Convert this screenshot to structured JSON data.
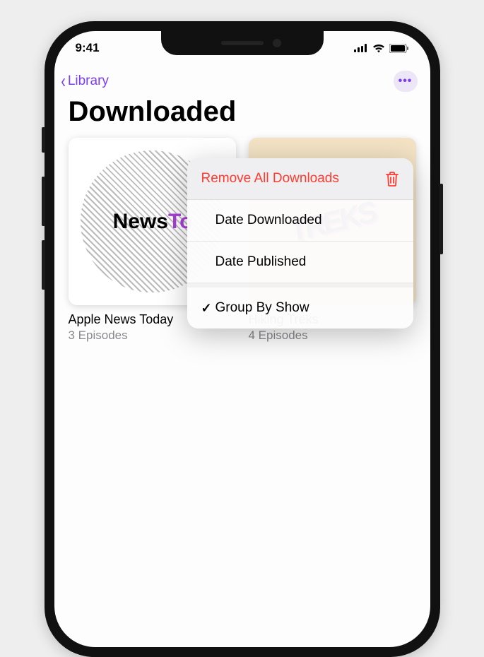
{
  "status_bar": {
    "time": "9:41"
  },
  "nav": {
    "back_label": "Library",
    "more_label": "•••"
  },
  "page": {
    "title": "Downloaded"
  },
  "shows": [
    {
      "title": "Apple News Today",
      "subtitle": "3 Episodes",
      "art_text_1": "News",
      "art_text_2": "To"
    },
    {
      "title": "Hiking Treks",
      "subtitle": "4 Episodes",
      "art_text": "TREKS"
    }
  ],
  "menu": {
    "items": [
      {
        "label": "Remove All Downloads",
        "destructive": true,
        "icon": "trash"
      },
      {
        "label": "Date Downloaded"
      },
      {
        "label": "Date Published"
      },
      {
        "label": "Group By Show",
        "checked": true
      }
    ]
  }
}
